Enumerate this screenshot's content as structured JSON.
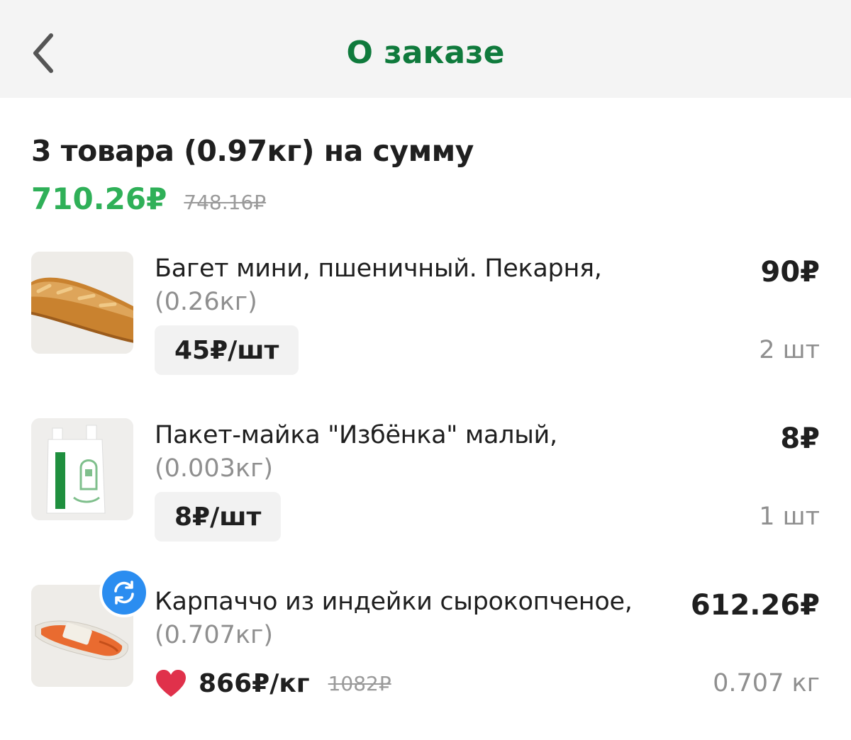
{
  "header": {
    "title": "О заказе",
    "back_icon": "chevron-left-icon"
  },
  "summary": {
    "title": "3 товара (0.97кг) на сумму",
    "total": "710.26₽",
    "total_old": "748.16₽"
  },
  "colors": {
    "brand_green": "#0f7a3c",
    "price_green": "#2fb058",
    "replace_blue": "#2b8df0",
    "favorite_red": "#e0314b"
  },
  "items": [
    {
      "name": "Багет мини, пшеничный. Пекарня,",
      "weight": "(0.26кг)",
      "unit_price": "45₽/шт",
      "price": "90₽",
      "quantity": "2 шт"
    },
    {
      "name": "Пакет-майка \"Избёнка\" малый,",
      "weight": "(0.003кг)",
      "unit_price": "8₽/шт",
      "price": "8₽",
      "quantity": "1 шт"
    },
    {
      "name": "Карпаччо из индейки сырокопченое,",
      "weight": "(0.707кг)",
      "unit_price": "866₽/кг",
      "unit_price_old": "1082₽",
      "price": "612.26₽",
      "quantity": "0.707 кг",
      "badge_icon": "replace-icon",
      "favorite_icon": "heart-icon"
    }
  ]
}
